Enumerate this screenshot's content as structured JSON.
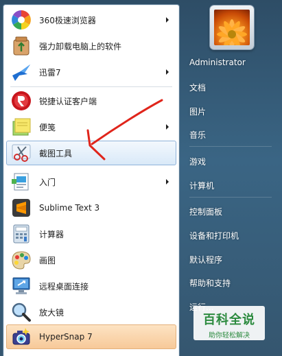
{
  "programs": [
    {
      "label": "360极速浏览器",
      "icon": "browser-360-icon",
      "has_submenu": true
    },
    {
      "label": "强力卸载电脑上的软件",
      "icon": "uninstaller-icon",
      "has_submenu": false
    },
    {
      "label": "迅雷7",
      "icon": "thunder-bird-icon",
      "has_submenu": true
    },
    {
      "label": "锐捷认证客户端",
      "icon": "ruijie-icon",
      "has_submenu": false
    },
    {
      "label": "便笺",
      "icon": "sticky-notes-icon",
      "has_submenu": true
    },
    {
      "label": "截图工具",
      "icon": "snipping-tool-icon",
      "has_submenu": false,
      "state": "selected"
    },
    {
      "label": "入门",
      "icon": "getting-started-icon",
      "has_submenu": true
    },
    {
      "label": "Sublime Text 3",
      "icon": "sublime-text-icon",
      "has_submenu": false
    },
    {
      "label": "计算器",
      "icon": "calculator-icon",
      "has_submenu": false
    },
    {
      "label": "画图",
      "icon": "paint-icon",
      "has_submenu": false
    },
    {
      "label": "远程桌面连接",
      "icon": "remote-desktop-icon",
      "has_submenu": false
    },
    {
      "label": "放大镜",
      "icon": "magnifier-icon",
      "has_submenu": false
    },
    {
      "label": "HyperSnap 7",
      "icon": "hypersnap-icon",
      "has_submenu": false,
      "state": "highlighted"
    }
  ],
  "right_pane": {
    "user_name": "Administrator",
    "items": [
      "文档",
      "图片",
      "音乐",
      "游戏",
      "计算机",
      "控制面板",
      "设备和打印机",
      "默认程序",
      "帮助和支持",
      "运行..."
    ]
  },
  "watermark": {
    "title": "百科全说",
    "subtitle": "助你轻松解决"
  },
  "colors": {
    "annotation_arrow": "#e0251b",
    "selection_border": "#8fb2d9",
    "highlight_fill": "#f7c999",
    "watermark_green": "#2b8a3e"
  }
}
